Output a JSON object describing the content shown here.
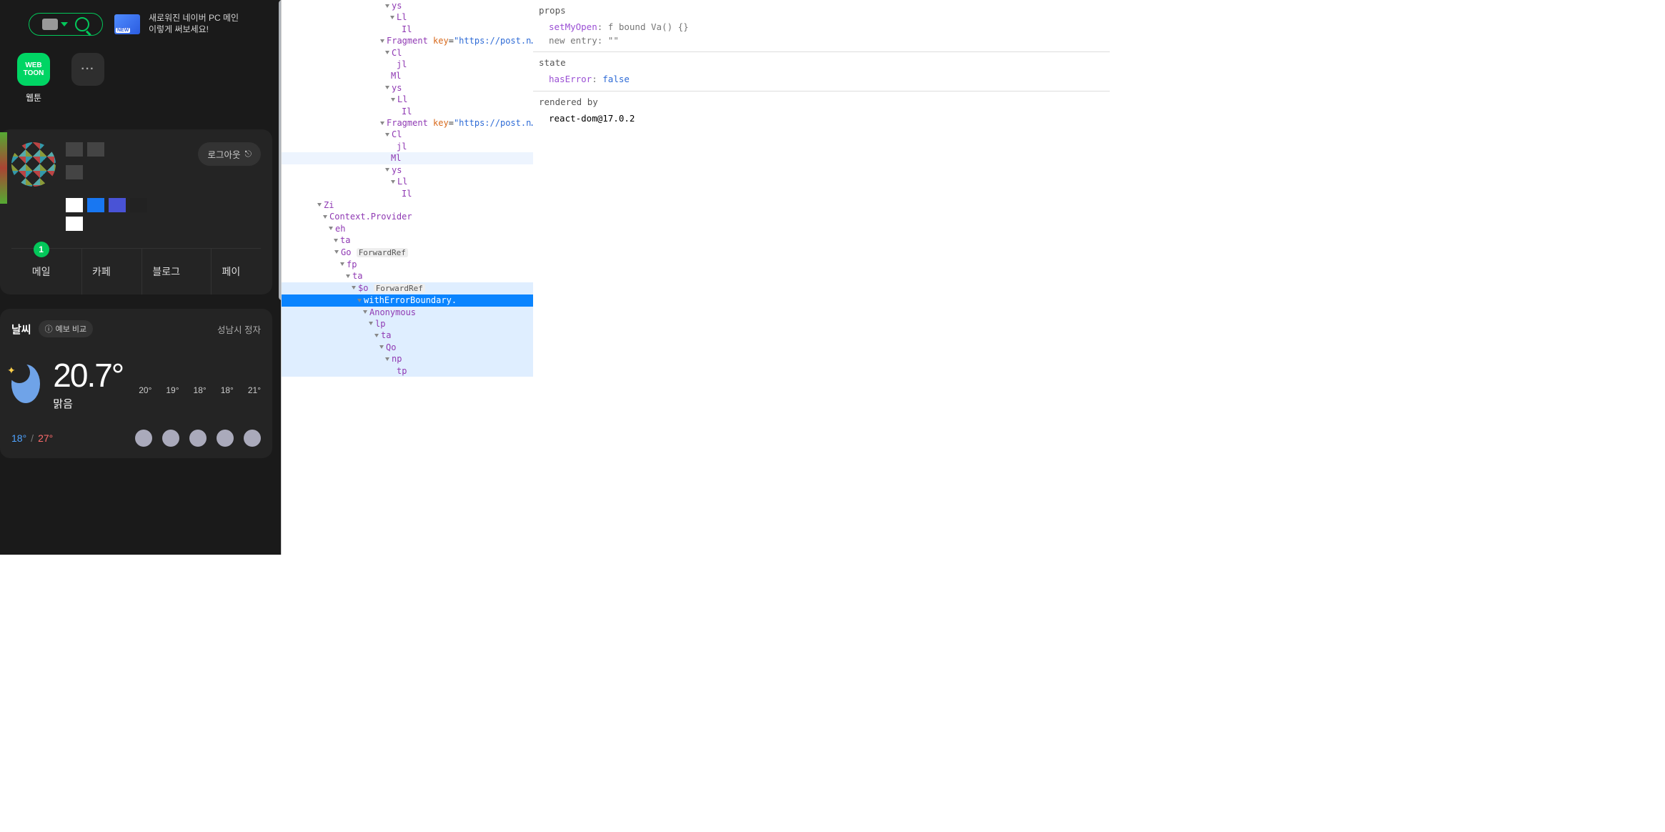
{
  "left": {
    "promo_line1": "새로워진 네이버 PC 메인",
    "promo_line2": "이렇게 써보세요!",
    "apps": {
      "webtoon": "웹툰",
      "more": "···"
    },
    "logout": "로그아웃",
    "services": {
      "mail": "메일",
      "mail_badge": "1",
      "cafe": "카페",
      "blog": "블로그",
      "pay": "페이"
    },
    "weather": {
      "title": "날씨",
      "chip_icon": "ⓘ",
      "chip": "예보 비교",
      "loc": "성남시 정자",
      "temp": "20.7°",
      "cond": "맑음",
      "low": "18°",
      "high": "27°",
      "hours": [
        "20°",
        "19°",
        "18°",
        "18°",
        "21°"
      ]
    }
  },
  "tree": [
    {
      "ind": 145,
      "arrow": true,
      "type": "c",
      "text": "ys"
    },
    {
      "ind": 152,
      "arrow": true,
      "type": "c",
      "text": "Ll"
    },
    {
      "ind": 168,
      "arrow": false,
      "type": "c",
      "text": "Il"
    },
    {
      "ind": 138,
      "arrow": true,
      "type": "frag",
      "text": "Fragment",
      "key": "\"https://post.n…\""
    },
    {
      "ind": 145,
      "arrow": true,
      "type": "c",
      "text": "Cl"
    },
    {
      "ind": 161,
      "arrow": false,
      "type": "c",
      "text": "jl"
    },
    {
      "ind": 153,
      "arrow": false,
      "type": "c",
      "text": "Ml"
    },
    {
      "ind": 145,
      "arrow": true,
      "type": "c",
      "text": "ys"
    },
    {
      "ind": 153,
      "arrow": true,
      "type": "c",
      "text": "Ll"
    },
    {
      "ind": 168,
      "arrow": false,
      "type": "c",
      "text": "Il"
    },
    {
      "ind": 138,
      "arrow": true,
      "type": "frag",
      "text": "Fragment",
      "key": "\"https://post.n…\""
    },
    {
      "ind": 145,
      "arrow": true,
      "type": "c",
      "text": "Cl"
    },
    {
      "ind": 161,
      "arrow": false,
      "type": "c",
      "text": "jl"
    },
    {
      "ind": 153,
      "arrow": false,
      "type": "c",
      "text": "Ml",
      "cls": "hov"
    },
    {
      "ind": 145,
      "arrow": true,
      "type": "c",
      "text": "ys"
    },
    {
      "ind": 153,
      "arrow": true,
      "type": "c",
      "text": "Ll"
    },
    {
      "ind": 168,
      "arrow": false,
      "type": "c",
      "text": "Il"
    },
    {
      "ind": 50,
      "arrow": true,
      "type": "c",
      "text": "Zi"
    },
    {
      "ind": 58,
      "arrow": true,
      "type": "c",
      "text": "Context.Provider"
    },
    {
      "ind": 66,
      "arrow": true,
      "type": "c",
      "text": "eh"
    },
    {
      "ind": 73,
      "arrow": true,
      "type": "c",
      "text": "ta"
    },
    {
      "ind": 74,
      "arrow": true,
      "type": "tag",
      "text": "Go",
      "tag": "ForwardRef"
    },
    {
      "ind": 82,
      "arrow": true,
      "type": "c",
      "text": "fp"
    },
    {
      "ind": 90,
      "arrow": true,
      "type": "c",
      "text": "ta"
    },
    {
      "ind": 98,
      "arrow": true,
      "type": "tag",
      "text": "$o",
      "tag": "ForwardRef",
      "cls": "path"
    },
    {
      "ind": 106,
      "arrow": true,
      "type": "c",
      "text": "withErrorBoundary.",
      "cls": "sel"
    },
    {
      "ind": 114,
      "arrow": true,
      "type": "c",
      "text": "Anonymous",
      "cls": "path"
    },
    {
      "ind": 122,
      "arrow": true,
      "type": "c",
      "text": "lp",
      "cls": "path"
    },
    {
      "ind": 130,
      "arrow": true,
      "type": "c",
      "text": "ta",
      "cls": "path"
    },
    {
      "ind": 137,
      "arrow": true,
      "type": "c",
      "text": "Qo",
      "cls": "path"
    },
    {
      "ind": 145,
      "arrow": true,
      "type": "c",
      "text": "np",
      "cls": "path"
    },
    {
      "ind": 161,
      "arrow": false,
      "type": "c",
      "text": "tp",
      "cls": "path"
    }
  ],
  "side": {
    "props_head": "props",
    "props": {
      "setMyOpen_key": "setMyOpen",
      "setMyOpen_val": "f bound Va() {}",
      "newentry_key": "new entry",
      "newentry_val": "\"\""
    },
    "state_head": "state",
    "state": {
      "hasError_key": "hasError",
      "hasError_val": "false"
    },
    "rendered_head": "rendered by",
    "rendered_by": "react-dom@17.0.2"
  }
}
